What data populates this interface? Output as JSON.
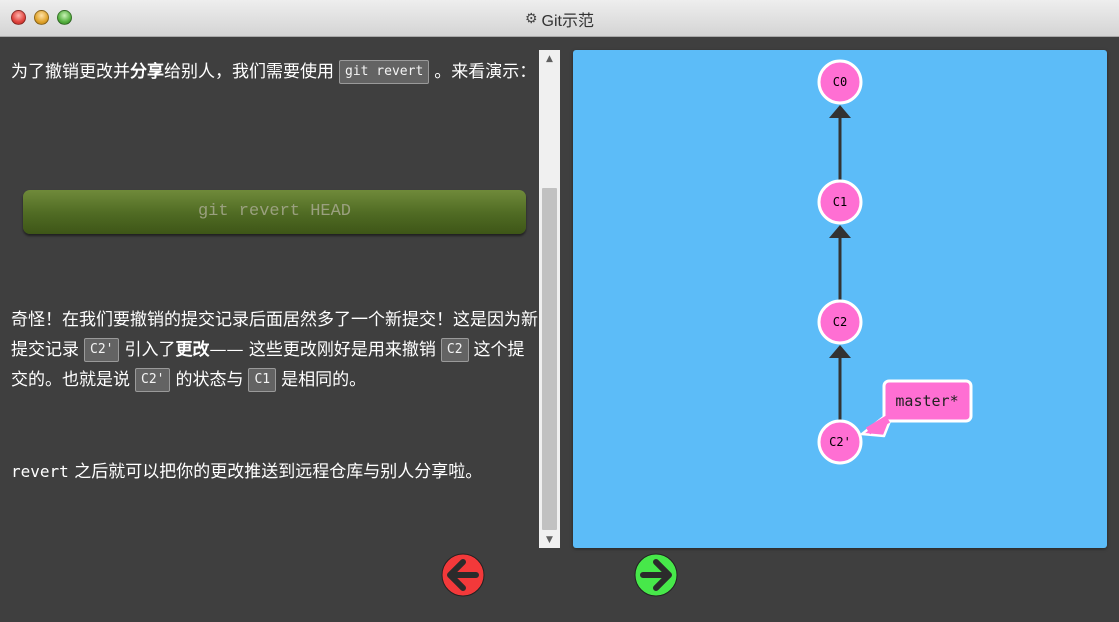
{
  "window": {
    "title": "Git示范",
    "icon": "gear-icon"
  },
  "text": {
    "p1_a": "为了撤销更改并",
    "p1_b": "分享",
    "p1_c": "给别人，我们需要使用",
    "p1_code": "git revert",
    "p1_d": "。来看演示：",
    "command": "git revert HEAD",
    "p2_a": "奇怪！在我们要撤销的提交记录后面居然多了一个新提交！这是因为新提交记录",
    "p2_code1": "C2'",
    "p2_b": "引入了",
    "p2_c": "更改",
    "p2_d": "—— 这些更改刚好是用来撤销",
    "p2_code2": "C2",
    "p2_e": "这个提交的。也就是说",
    "p2_code3": "C2'",
    "p2_f": "的状态与",
    "p2_code4": "C1",
    "p2_g": "是相同的。",
    "p3_mono": "revert",
    "p3_a": "之后就可以把你的更改推送到远程仓库与别人分享啦。"
  },
  "graph": {
    "commits": [
      "C0",
      "C1",
      "C2",
      "C2'"
    ],
    "branch": "master*",
    "colors": {
      "background": "#5cbcf8",
      "commit": "#ff6fd3",
      "stroke": "#ffffff",
      "edge": "#333333"
    }
  },
  "nav": {
    "back_color": "#f3393a",
    "forward_color": "#47e84a",
    "back_icon": "arrow-left-icon",
    "forward_icon": "arrow-right-icon"
  }
}
